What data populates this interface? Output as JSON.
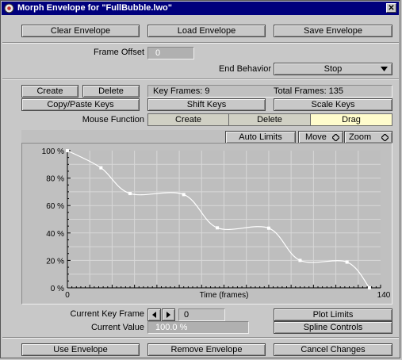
{
  "window": {
    "title": "Morph Envelope for \"FullBubble.lwo\"",
    "close_glyph": "✕"
  },
  "top_buttons": {
    "clear": "Clear Envelope",
    "load": "Load Envelope",
    "save": "Save Envelope"
  },
  "settings": {
    "frame_offset_label": "Frame Offset",
    "frame_offset_value": "0",
    "end_behavior_label": "End Behavior",
    "end_behavior_value": "Stop"
  },
  "keys": {
    "create": "Create",
    "delete": "Delete",
    "key_frames": "Key Frames: 9",
    "total_frames": "Total Frames: 135",
    "copy_paste": "Copy/Paste Keys",
    "shift": "Shift Keys",
    "scale": "Scale Keys"
  },
  "mouse_function": {
    "label": "Mouse Function",
    "options": [
      "Create",
      "Delete",
      "Drag"
    ],
    "selected": "Drag",
    "selected_color": "#fffccc"
  },
  "graph_toolbar": {
    "auto_limits": "Auto Limits",
    "move": "Move",
    "zoom": "Zoom"
  },
  "chart_data": {
    "type": "line",
    "xlabel": "Time (frames)",
    "xlim": [
      0,
      140
    ],
    "x_tick_labels": [
      "0",
      "140"
    ],
    "ylim": [
      0,
      100
    ],
    "y_tick_labels": [
      "100 %",
      "80 %",
      "60 %",
      "40 %",
      "20 %",
      "0 %"
    ],
    "grid": true,
    "series": [
      {
        "keys_x": [
          0,
          15,
          28,
          52,
          67,
          90,
          104,
          125,
          135
        ],
        "keys_y": [
          100,
          87.5,
          68.75,
          68,
          43.75,
          43.5,
          20,
          18.75,
          0
        ],
        "color": "#ffffff"
      }
    ]
  },
  "bottom_controls": {
    "current_key_label": "Current Key Frame",
    "current_key_value": "0",
    "current_value_label": "Current Value",
    "current_value_value": "100.0 %",
    "plot_limits": "Plot Limits",
    "spline_controls": "Spline Controls"
  },
  "footer_buttons": {
    "use": "Use Envelope",
    "remove": "Remove Envelope",
    "cancel": "Cancel Changes"
  }
}
